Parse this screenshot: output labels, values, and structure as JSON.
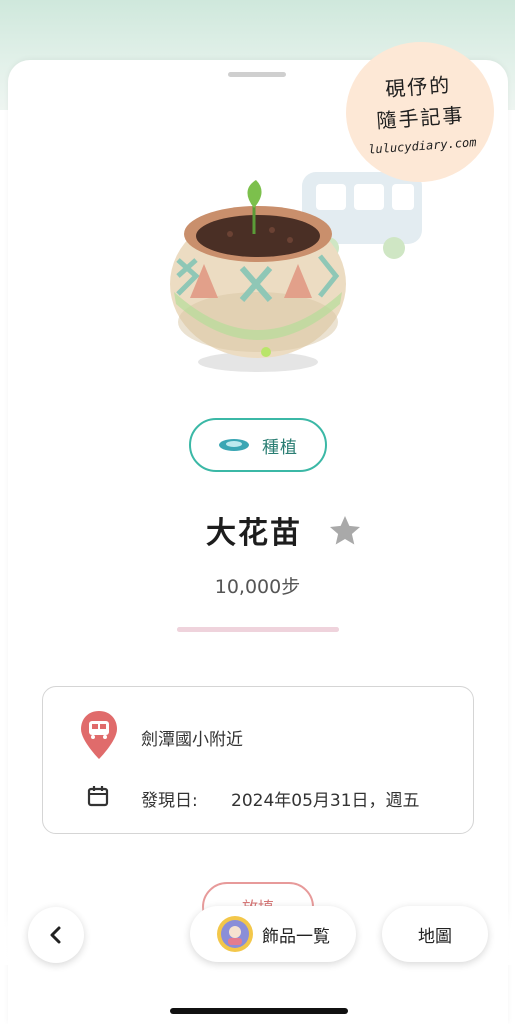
{
  "watermark": {
    "line1": "硯伃的",
    "line2": "隨手記事",
    "url": "lulucydiary.com"
  },
  "item": {
    "category": "種植",
    "category_icon": "saucer-icon",
    "name": "大花苗",
    "favorite_icon": "star-icon",
    "steps": "10,000步",
    "progress_fraction": 1.0
  },
  "info": {
    "location": "劍潭國小附近",
    "location_icon": "bus-stop-pin-icon",
    "date_label": "發現日:",
    "date_value": "2024年05月31日，週五",
    "date_icon": "calendar-icon"
  },
  "actions": {
    "partial_button": "放填"
  },
  "nav": {
    "back_icon": "chevron-left-icon",
    "ornaments_label": "飾品一覧",
    "map_label": "地圖"
  },
  "colors": {
    "accent_teal": "#3bb8a6",
    "pin_red": "#e06b6b",
    "star_gray": "#a9a9a9"
  }
}
